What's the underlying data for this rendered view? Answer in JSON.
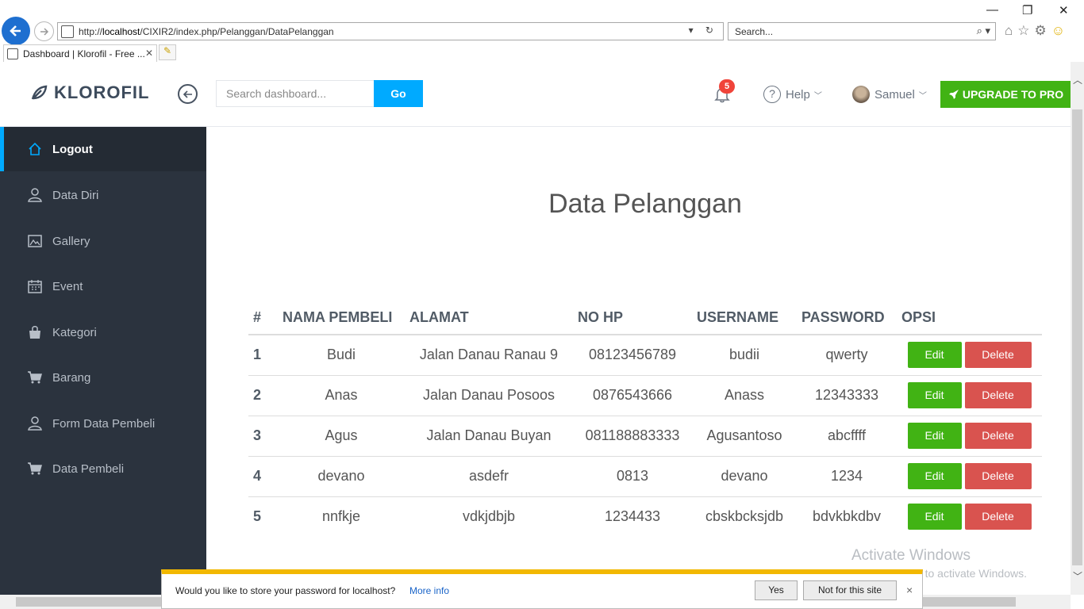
{
  "browser": {
    "url_prefix": "http://",
    "url_host": "localhost",
    "url_path": "/CIXIR2/index.php/Pelanggan/DataPelanggan",
    "search_placeholder": "Search...",
    "tab_title": "Dashboard | Klorofil - Free ...",
    "tab_close": "✕"
  },
  "header": {
    "brand": "KLOROFIL",
    "search_placeholder": "Search dashboard...",
    "go_label": "Go",
    "notif_count": "5",
    "help_label": "Help",
    "user_name": "Samuel",
    "upgrade_label": "UPGRADE TO PRO"
  },
  "sidebar": {
    "items": [
      {
        "label": "Logout",
        "icon": "home-icon"
      },
      {
        "label": "Data Diri",
        "icon": "user-icon"
      },
      {
        "label": "Gallery",
        "icon": "image-icon"
      },
      {
        "label": "Event",
        "icon": "calendar-icon"
      },
      {
        "label": "Kategori",
        "icon": "bag-icon"
      },
      {
        "label": "Barang",
        "icon": "cart-icon"
      },
      {
        "label": "Form Data Pembeli",
        "icon": "user-icon"
      },
      {
        "label": "Data Pembeli",
        "icon": "cart-icon"
      }
    ]
  },
  "main": {
    "title": "Data Pelanggan",
    "columns": [
      "#",
      "NAMA PEMBELI",
      "ALAMAT",
      "NO HP",
      "USERNAME",
      "PASSWORD",
      "OPSI"
    ],
    "edit_label": "Edit",
    "delete_label": "Delete",
    "rows": [
      {
        "no": "1",
        "nama": "Budi",
        "alamat": "Jalan Danau Ranau 9",
        "hp": "08123456789",
        "username": "budii",
        "password": "qwerty"
      },
      {
        "no": "2",
        "nama": "Anas",
        "alamat": "Jalan Danau Posoos",
        "hp": "0876543666",
        "username": "Anass",
        "password": "12343333"
      },
      {
        "no": "3",
        "nama": "Agus",
        "alamat": "Jalan Danau Buyan",
        "hp": "081188883333",
        "username": "Agusantoso",
        "password": "abcffff"
      },
      {
        "no": "4",
        "nama": "devano",
        "alamat": "asdefr",
        "hp": "0813",
        "username": "devano",
        "password": "1234"
      },
      {
        "no": "5",
        "nama": "nnfkje",
        "alamat": "vdkjdbjb",
        "hp": "1234433",
        "username": "cbskbcksjdb",
        "password": "bdvkbkdbv"
      }
    ]
  },
  "watermark": {
    "line1": "Activate Windows",
    "line2": "Go to Settings to activate Windows."
  },
  "password_bar": {
    "message": "Would you like to store your password for localhost?",
    "more_info": "More info",
    "yes": "Yes",
    "no": "Not for this site",
    "close": "×"
  },
  "colors": {
    "accent": "#00aaff",
    "success": "#41b314",
    "danger": "#d9534f",
    "sidebar_bg": "#2b333e"
  }
}
